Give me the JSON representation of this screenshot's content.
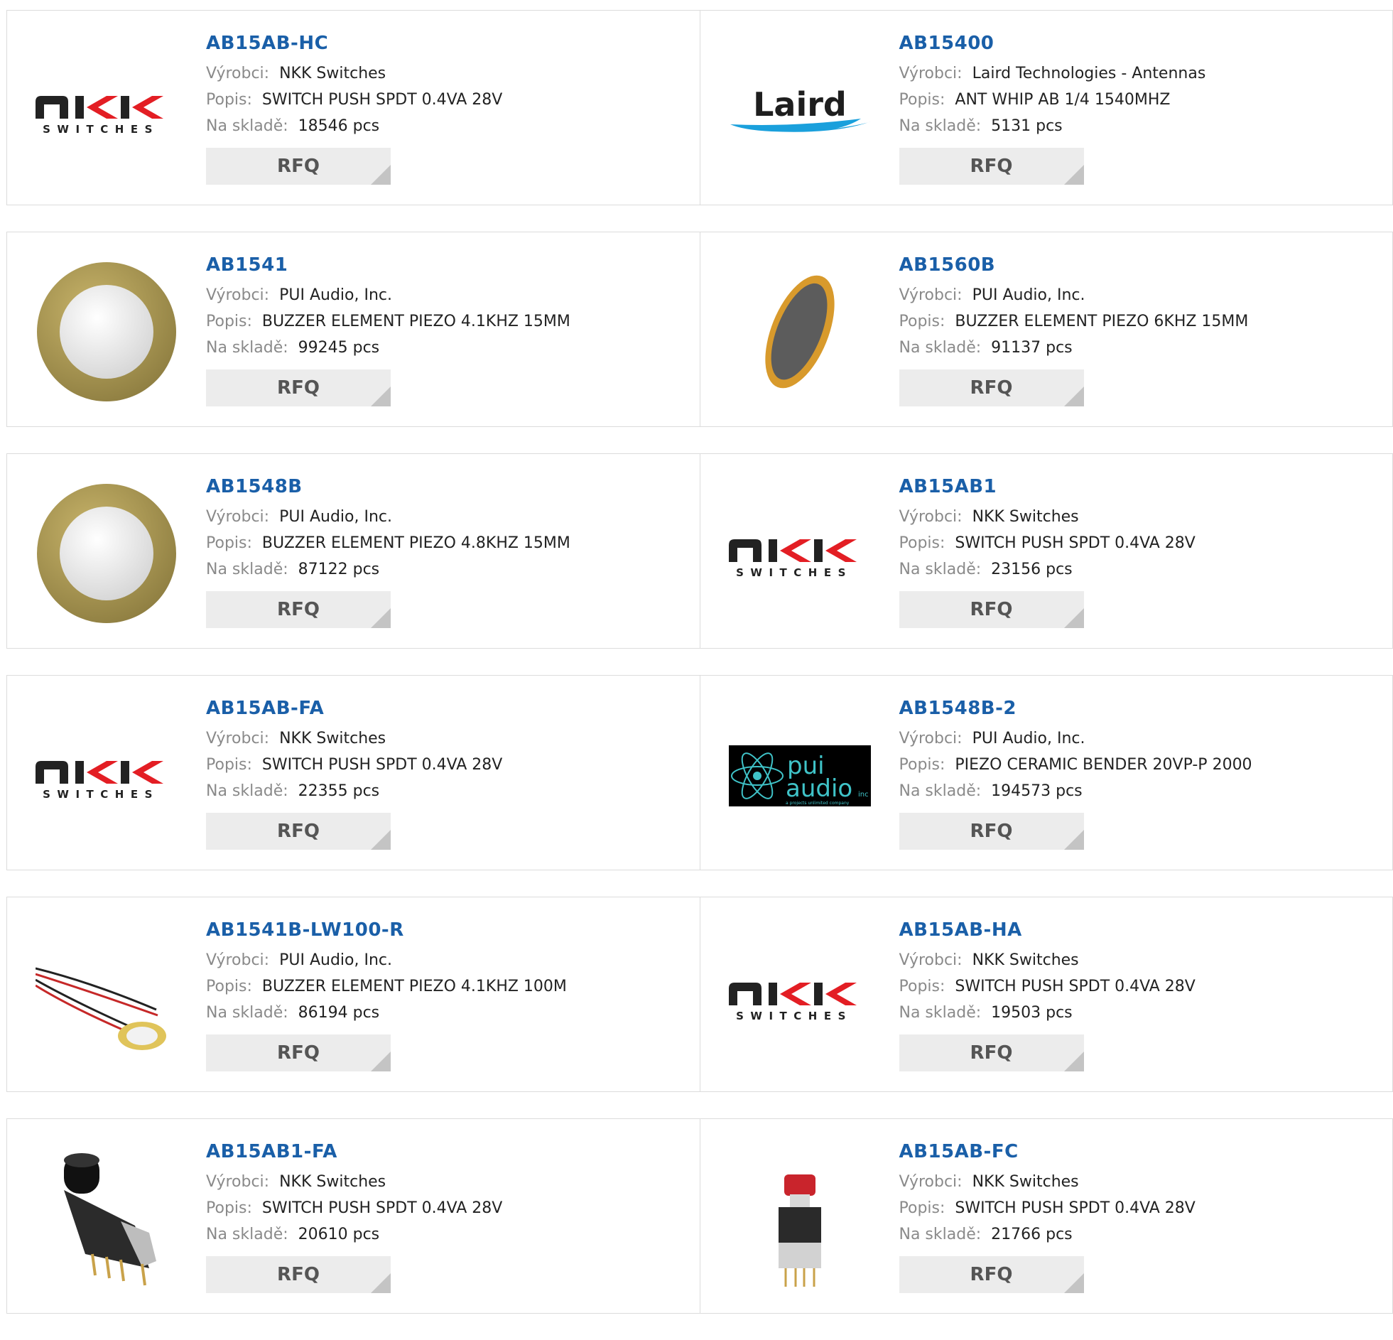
{
  "labels": {
    "manufacturer": "Výrobci:",
    "description": "Popis:",
    "stock": "Na skladě:",
    "rfq": "RFQ"
  },
  "products": [
    {
      "part": "AB15AB-HC",
      "manufacturer": "NKK Switches",
      "description": "SWITCH PUSH SPDT 0.4VA 28V",
      "stock": "18546 pcs",
      "image": "nkk-logo"
    },
    {
      "part": "AB15400",
      "manufacturer": "Laird Technologies - Antennas",
      "description": "ANT WHIP AB 1/4 1540MHZ",
      "stock": "5131 pcs",
      "image": "laird-logo"
    },
    {
      "part": "AB1541",
      "manufacturer": "PUI Audio, Inc.",
      "description": "BUZZER ELEMENT PIEZO 4.1KHZ 15MM",
      "stock": "99245 pcs",
      "image": "piezo-disc"
    },
    {
      "part": "AB1560B",
      "manufacturer": "PUI Audio, Inc.",
      "description": "BUZZER ELEMENT PIEZO 6KHZ 15MM",
      "stock": "91137 pcs",
      "image": "piezo-tilted"
    },
    {
      "part": "AB1548B",
      "manufacturer": "PUI Audio, Inc.",
      "description": "BUZZER ELEMENT PIEZO 4.8KHZ 15MM",
      "stock": "87122 pcs",
      "image": "piezo-disc"
    },
    {
      "part": "AB15AB1",
      "manufacturer": "NKK Switches",
      "description": "SWITCH PUSH SPDT 0.4VA 28V",
      "stock": "23156 pcs",
      "image": "nkk-logo"
    },
    {
      "part": "AB15AB-FA",
      "manufacturer": "NKK Switches",
      "description": "SWITCH PUSH SPDT 0.4VA 28V",
      "stock": "22355 pcs",
      "image": "nkk-logo"
    },
    {
      "part": "AB1548B-2",
      "manufacturer": "PUI Audio, Inc.",
      "description": "PIEZO CERAMIC BENDER 20VP-P 2000",
      "stock": "194573 pcs",
      "image": "pui-audio-logo"
    },
    {
      "part": "AB1541B-LW100-R",
      "manufacturer": "PUI Audio, Inc.",
      "description": "BUZZER ELEMENT PIEZO 4.1KHZ 100M",
      "stock": "86194 pcs",
      "image": "piezo-wired"
    },
    {
      "part": "AB15AB-HA",
      "manufacturer": "NKK Switches",
      "description": "SWITCH PUSH SPDT 0.4VA 28V",
      "stock": "19503 pcs",
      "image": "nkk-logo"
    },
    {
      "part": "AB15AB1-FA",
      "manufacturer": "NKK Switches",
      "description": "SWITCH PUSH SPDT 0.4VA 28V",
      "stock": "20610 pcs",
      "image": "black-pushbutton"
    },
    {
      "part": "AB15AB-FC",
      "manufacturer": "NKK Switches",
      "description": "SWITCH PUSH SPDT 0.4VA 28V",
      "stock": "21766 pcs",
      "image": "red-pushbutton"
    }
  ],
  "logo_text": {
    "nkk_sub": "SWITCHES",
    "laird": "Laird",
    "pui_top": "pui",
    "pui_bottom": "audio",
    "pui_inc": "inc",
    "pui_tag": "a projects unlimited company"
  }
}
